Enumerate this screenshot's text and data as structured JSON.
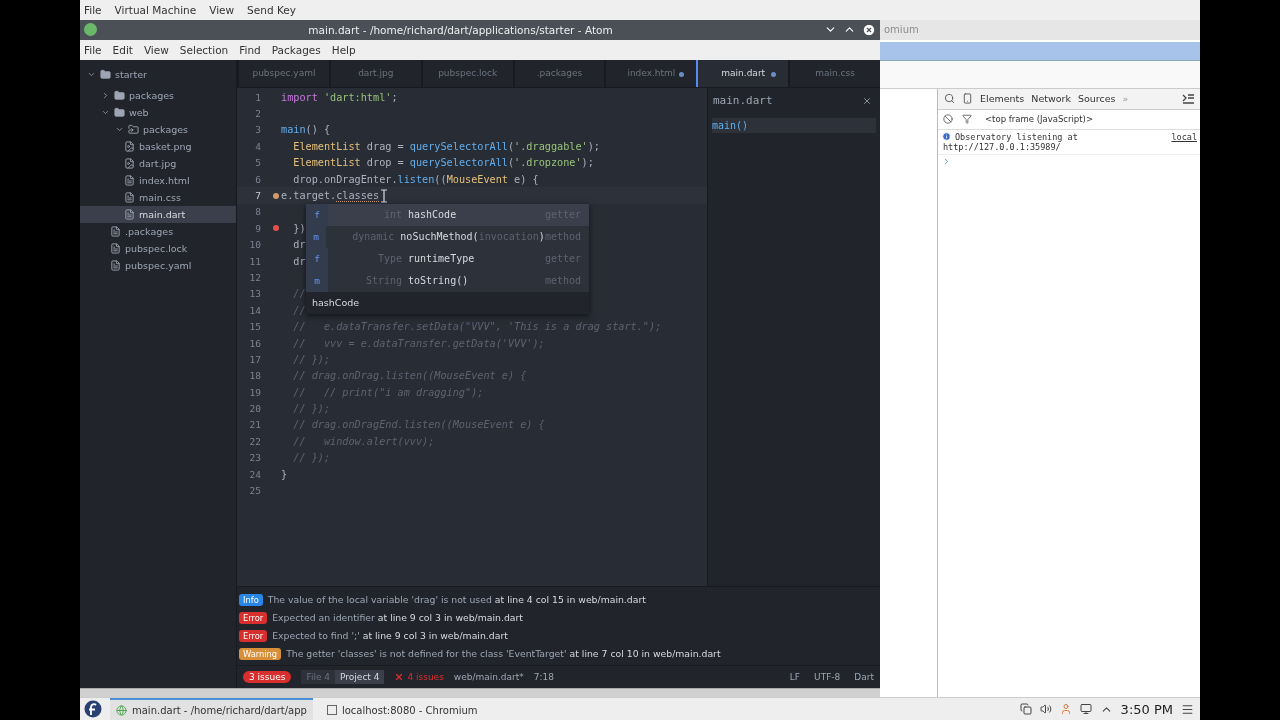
{
  "vm_menu": [
    "File",
    "Virtual Machine",
    "View",
    "Send Key"
  ],
  "atom": {
    "title": "main.dart - /home/richard/dart/applications/starter - Atom",
    "menu": [
      "File",
      "Edit",
      "View",
      "Selection",
      "Find",
      "Packages",
      "Help"
    ],
    "tree": [
      {
        "name": "starter",
        "kind": "folder",
        "expanded": true,
        "selected": false,
        "children": [
          {
            "name": "packages",
            "kind": "folder",
            "expanded": false,
            "selected": false
          },
          {
            "name": "web",
            "kind": "folder",
            "expanded": true,
            "selected": false,
            "children": [
              {
                "name": "packages",
                "kind": "link-folder",
                "expanded": true,
                "selected": false
              },
              {
                "name": "basket.png",
                "kind": "image",
                "selected": false
              },
              {
                "name": "dart.jpg",
                "kind": "image",
                "selected": false
              },
              {
                "name": "index.html",
                "kind": "file",
                "selected": false
              },
              {
                "name": "main.css",
                "kind": "file",
                "selected": false
              },
              {
                "name": "main.dart",
                "kind": "file",
                "selected": true
              }
            ]
          },
          {
            "name": ".packages",
            "kind": "file",
            "selected": false
          },
          {
            "name": "pubspec.lock",
            "kind": "file",
            "selected": false
          },
          {
            "name": "pubspec.yaml",
            "kind": "file",
            "selected": false
          }
        ]
      }
    ],
    "tabs": [
      {
        "label": "pubspec.yaml",
        "modified": false,
        "selected": false
      },
      {
        "label": "dart.jpg",
        "modified": false,
        "selected": false
      },
      {
        "label": "pubspec.lock",
        "modified": false,
        "selected": false
      },
      {
        "label": ".packages",
        "modified": false,
        "selected": false
      },
      {
        "label": "index.html",
        "modified": true,
        "selected": false
      },
      {
        "label": "main.dart",
        "modified": true,
        "selected": true
      },
      {
        "label": "main.css",
        "modified": false,
        "selected": false
      }
    ],
    "editor": {
      "lines": [
        {
          "number": "1",
          "warning": false,
          "error": false,
          "current": false,
          "tokens": [
            {
              "text": "import ",
              "kind": "keyword"
            },
            {
              "text": "'dart:html'",
              "kind": "string"
            },
            {
              "text": ";",
              "kind": "plain"
            }
          ]
        },
        {
          "number": "2",
          "warning": false,
          "error": false,
          "current": false
        },
        {
          "number": "3",
          "warning": false,
          "error": false,
          "current": false,
          "tokens": [
            {
              "text": "main",
              "kind": "function"
            },
            {
              "text": "() {",
              "kind": "plain"
            }
          ]
        },
        {
          "number": "4",
          "warning": false,
          "error": false,
          "current": false,
          "tokens": [
            {
              "text": "  ElementList",
              "kind": "type"
            },
            {
              "text": " drag = ",
              "kind": "plain"
            },
            {
              "text": "querySelectorAll",
              "kind": "function"
            },
            {
              "text": "(",
              "kind": "plain"
            },
            {
              "text": "'.draggable'",
              "kind": "string"
            },
            {
              "text": ");",
              "kind": "plain"
            }
          ]
        },
        {
          "number": "5",
          "warning": false,
          "error": false,
          "current": false,
          "tokens": [
            {
              "text": "  ElementList",
              "kind": "type"
            },
            {
              "text": " drop = ",
              "kind": "plain"
            },
            {
              "text": "querySelectorAll",
              "kind": "function"
            },
            {
              "text": "(",
              "kind": "plain"
            },
            {
              "text": "'.dropzone'",
              "kind": "string"
            },
            {
              "text": ");",
              "kind": "plain"
            }
          ]
        },
        {
          "number": "6",
          "warning": false,
          "error": false,
          "current": false,
          "tokens": [
            {
              "text": "  drop.onDragEnter.",
              "kind": "plain"
            },
            {
              "text": "listen",
              "kind": "function"
            },
            {
              "text": "((",
              "kind": "plain"
            },
            {
              "text": "MouseEvent",
              "kind": "type"
            },
            {
              "text": " e) {",
              "kind": "plain"
            }
          ]
        },
        {
          "number": "7",
          "warning": true,
          "error": false,
          "current": true,
          "tokens": [
            {
              "text": "e.target.",
              "kind": "plain"
            },
            {
              "text": "classes",
              "kind": "flagged"
            }
          ]
        },
        {
          "number": "8",
          "warning": false,
          "error": false,
          "current": false
        },
        {
          "number": "9",
          "warning": false,
          "error": true,
          "current": false,
          "tokens": [
            {
              "text": "  })",
              "kind": "plain"
            }
          ]
        },
        {
          "number": "10",
          "warning": false,
          "error": false,
          "current": false,
          "tokens": [
            {
              "text": "  dr",
              "kind": "plain"
            }
          ]
        },
        {
          "number": "11",
          "warning": false,
          "error": false,
          "current": false,
          "tokens": [
            {
              "text": "  dr",
              "kind": "plain"
            }
          ]
        },
        {
          "number": "12",
          "warning": false,
          "error": false,
          "current": false
        },
        {
          "number": "13",
          "warning": false,
          "error": false,
          "current": false,
          "tokens": [
            {
              "text": "  //",
              "kind": "comment"
            }
          ]
        },
        {
          "number": "14",
          "warning": false,
          "error": false,
          "current": false,
          "tokens": [
            {
              "text": "  //",
              "kind": "comment"
            }
          ]
        },
        {
          "number": "15",
          "warning": false,
          "error": false,
          "current": false,
          "tokens": [
            {
              "text": "  //   e.dataTransfer.setData(\"VVV\", 'This is a drag start.\");",
              "kind": "comment"
            }
          ]
        },
        {
          "number": "16",
          "warning": false,
          "error": false,
          "current": false,
          "tokens": [
            {
              "text": "  //   vvv = e.dataTransfer.getData('VVV');",
              "kind": "comment"
            }
          ]
        },
        {
          "number": "17",
          "warning": false,
          "error": false,
          "current": false,
          "tokens": [
            {
              "text": "  // });",
              "kind": "comment"
            }
          ]
        },
        {
          "number": "18",
          "warning": false,
          "error": false,
          "current": false,
          "tokens": [
            {
              "text": "  // drag.onDrag.listen((MouseEvent e) {",
              "kind": "comment"
            }
          ]
        },
        {
          "number": "19",
          "warning": false,
          "error": false,
          "current": false,
          "tokens": [
            {
              "text": "  //   // print(\"i am dragging\");",
              "kind": "comment"
            }
          ]
        },
        {
          "number": "20",
          "warning": false,
          "error": false,
          "current": false,
          "tokens": [
            {
              "text": "  // });",
              "kind": "comment"
            }
          ]
        },
        {
          "number": "21",
          "warning": false,
          "error": false,
          "current": false,
          "tokens": [
            {
              "text": "  // drag.onDragEnd.listen((MouseEvent e) {",
              "kind": "comment"
            }
          ]
        },
        {
          "number": "22",
          "warning": false,
          "error": false,
          "current": false,
          "tokens": [
            {
              "text": "  //   window.alert(vvv);",
              "kind": "comment"
            }
          ]
        },
        {
          "number": "23",
          "warning": false,
          "error": false,
          "current": false,
          "tokens": [
            {
              "text": "  // });",
              "kind": "comment"
            }
          ]
        },
        {
          "number": "24",
          "warning": false,
          "error": false,
          "current": false,
          "tokens": [
            {
              "text": "}",
              "kind": "plain"
            }
          ]
        },
        {
          "number": "25",
          "warning": false,
          "error": false,
          "current": false
        }
      ],
      "completion": {
        "items": [
          {
            "letter": "f",
            "type": "int",
            "name": "hashCode",
            "category": "getter",
            "selected": true
          },
          {
            "letter": "m",
            "type": "dynamic",
            "name": "noSuchMethod(",
            "args": "invocation",
            "close": ")",
            "category": "method",
            "selected": false
          },
          {
            "letter": "f",
            "type": "Type",
            "name": "runtimeType",
            "category": "getter",
            "selected": false
          },
          {
            "letter": "m",
            "type": "String",
            "name": "toString()",
            "category": "method",
            "selected": false
          }
        ],
        "description": "hashCode"
      }
    },
    "outline": {
      "title": "main.dart",
      "items": [
        {
          "label": "main()",
          "selected": true
        }
      ]
    },
    "linter": [
      {
        "kind": "info",
        "badge": "Info",
        "message": "The value of the local variable 'drag' is not used",
        "location": "at line 4 col 15 in web/main.dart"
      },
      {
        "kind": "error",
        "badge": "Error",
        "message": "Expected an identifier",
        "location": "at line 9 col 3 in web/main.dart"
      },
      {
        "kind": "error",
        "badge": "Error",
        "message": "Expected to find ';'",
        "location": "at line 9 col 3 in web/main.dart"
      },
      {
        "kind": "warning",
        "badge": "Warning",
        "message": "The getter 'classes' is not defined for the class 'EventTarget'",
        "location": "at line 7 col 10 in web/main.dart"
      }
    ],
    "status": {
      "issue_pill": "3 issues",
      "scopes": [
        {
          "label": "File 4",
          "selected": false
        },
        {
          "label": "Project 4",
          "selected": true
        }
      ],
      "error_count": "4 issues",
      "file": "web/main.dart*",
      "cursor": "7:18",
      "right": [
        "LF",
        "UTF-8",
        "Dart"
      ]
    }
  },
  "browser": {
    "title_fragment": "omium",
    "devtools": {
      "tabs": [
        "Elements",
        "Network",
        "Sources"
      ],
      "more": "»",
      "context": "<top frame (JavaScript)>",
      "messages": [
        {
          "text": "Observatory listening at",
          "url": "http://127.0.0.1:35989/",
          "source": "local"
        }
      ]
    }
  },
  "taskbar": {
    "tasks": [
      {
        "label": "main.dart - /home/richard/dart/app",
        "selected": true
      },
      {
        "label": "localhost:8080 - Chromium",
        "selected": false
      }
    ],
    "clock": "3:50 PM"
  }
}
